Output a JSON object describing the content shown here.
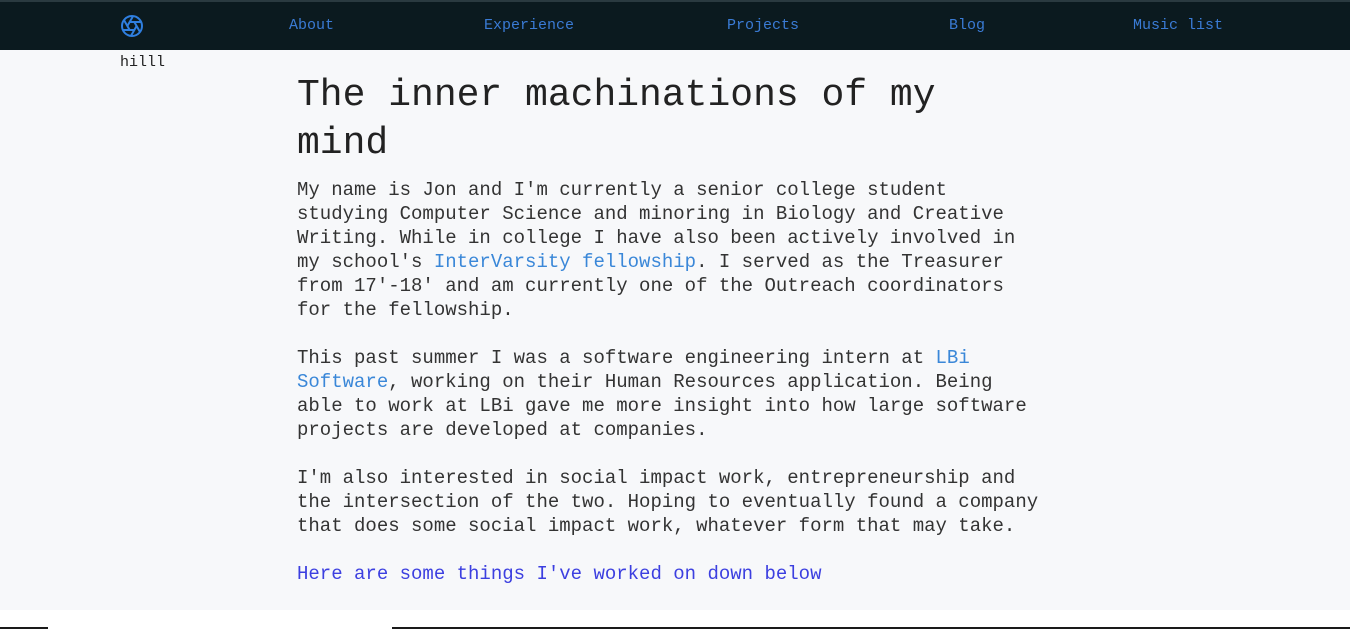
{
  "nav": {
    "items": [
      {
        "label": "About"
      },
      {
        "label": "Experience"
      },
      {
        "label": "Projects"
      },
      {
        "label": "Blog"
      },
      {
        "label": "Music list"
      }
    ],
    "logo_icon": "aperture-icon",
    "accent_color": "#3a7bd5"
  },
  "side_note": "hilll",
  "main": {
    "title": "The inner machinations of my mind",
    "intro": {
      "text_before_link": "My name is Jon and I'm currently a senior college student studying Computer Science and minoring in Biology and Creative Writing. While in college I have also been actively involved in my school's ",
      "link_text": "InterVarsity fellowship",
      "text_after_link": ". I served as the Treasurer from 17'-18' and am currently one of the Outreach coordinators for the fellowship."
    },
    "internship": {
      "text_before_link": "This past summer I was a software engineering intern at ",
      "link_text": "LBi Software",
      "text_after_link": ", working on their Human Resources application. Being able to work at LBi gave me more insight into how large software projects are developed at companies."
    },
    "interests": "I'm also interested in social impact work, entrepreneurship and the intersection of the two. Hoping to eventually found a company that does some social impact work, whatever form that may take.",
    "cta_link": "Here are some things I've worked on down below"
  }
}
